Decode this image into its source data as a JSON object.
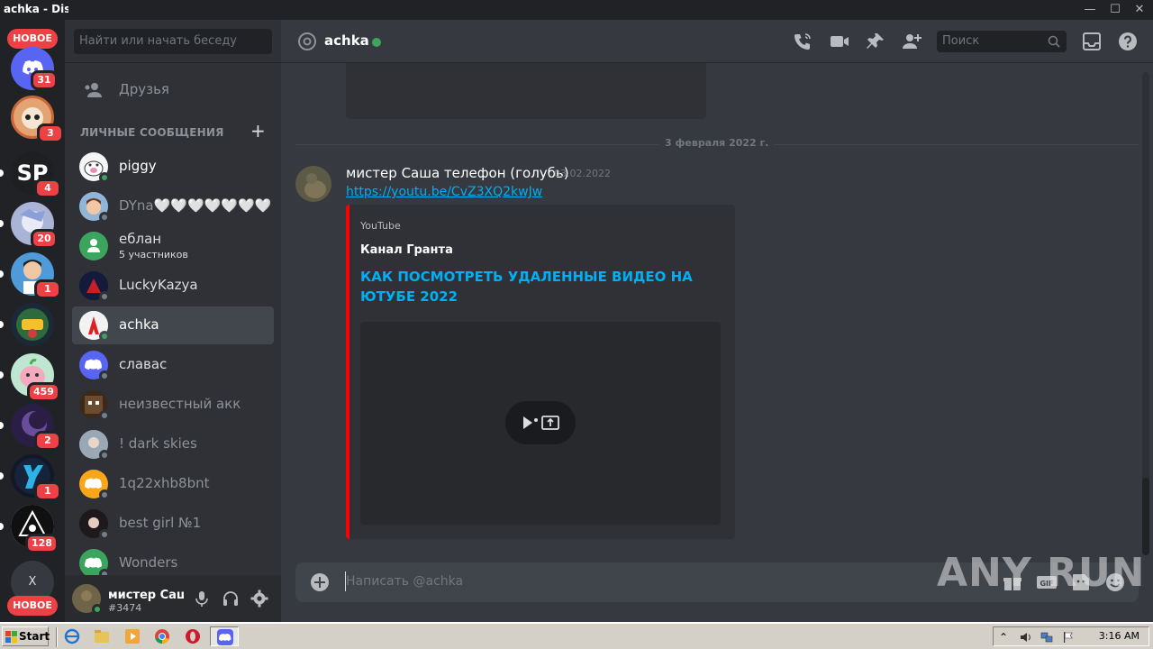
{
  "window": {
    "title": "achka - Discord"
  },
  "rail": {
    "new_label_top": "НОВОЕ",
    "new_label_bottom": "НОВОЕ",
    "home_badge": "31",
    "servers": [
      {
        "badge": "3"
      },
      {
        "label": "SP",
        "badge": "4"
      },
      {
        "badge": "20"
      },
      {
        "badge": "1"
      },
      {
        "badge": ""
      },
      {
        "badge": "459"
      },
      {
        "badge": "2"
      },
      {
        "badge": "1"
      },
      {
        "badge": "128"
      },
      {
        "label": "X"
      }
    ]
  },
  "sidebar": {
    "search_placeholder": "Найти или начать беседу",
    "friends_label": "Друзья",
    "dm_header": "ЛИЧНЫЕ СООБЩЕНИЯ",
    "add_dm_symbol": "+",
    "dms": [
      {
        "name": "piggy",
        "status": "online"
      },
      {
        "name": "DYna🤍🤍🤍🤍🤍🤍🤍…",
        "status": "offline"
      },
      {
        "name": "еблан",
        "sub": "5 участников",
        "status": "group"
      },
      {
        "name": "LuckyKazya",
        "status": "offline"
      },
      {
        "name": "achka",
        "status": "online"
      },
      {
        "name": "славас",
        "status": "offline"
      },
      {
        "name": "неизвестный акк",
        "status": "offline"
      },
      {
        "name": "! dark skies",
        "status": "offline"
      },
      {
        "name": "1q22xhb8bnt",
        "status": "offline"
      },
      {
        "name": "best girl №1",
        "status": "offline"
      },
      {
        "name": "Wonders",
        "status": "offline"
      }
    ]
  },
  "user_panel": {
    "username": "мистер Саша телефон (голубь)",
    "tag": "#3474"
  },
  "chat": {
    "header_title": "achka",
    "search_placeholder": "Поиск",
    "date_divider": "3 февраля 2022 г.",
    "message": {
      "author": "мистер Саша телефон (голубь)",
      "timestamp": "03.02.2022",
      "link": "https://youtu.be/CvZ3XQ2kwJw"
    },
    "embed": {
      "provider": "YouTube",
      "author": "Канал Гранта",
      "title": "КАК ПОСМОТРЕТЬ УДАЛЕННЫЕ ВИДЕО НА ЮТУБЕ 2022",
      "color": "#ff0000"
    },
    "composer_placeholder": "Написать @achka"
  },
  "watermark": "ANY RUN",
  "taskbar": {
    "start_label": "Start",
    "clock": "3:16 AM"
  },
  "colors": {
    "accent": "#5865f2",
    "online": "#3ba55d",
    "badge": "#ed4245",
    "link": "#00aff4"
  }
}
